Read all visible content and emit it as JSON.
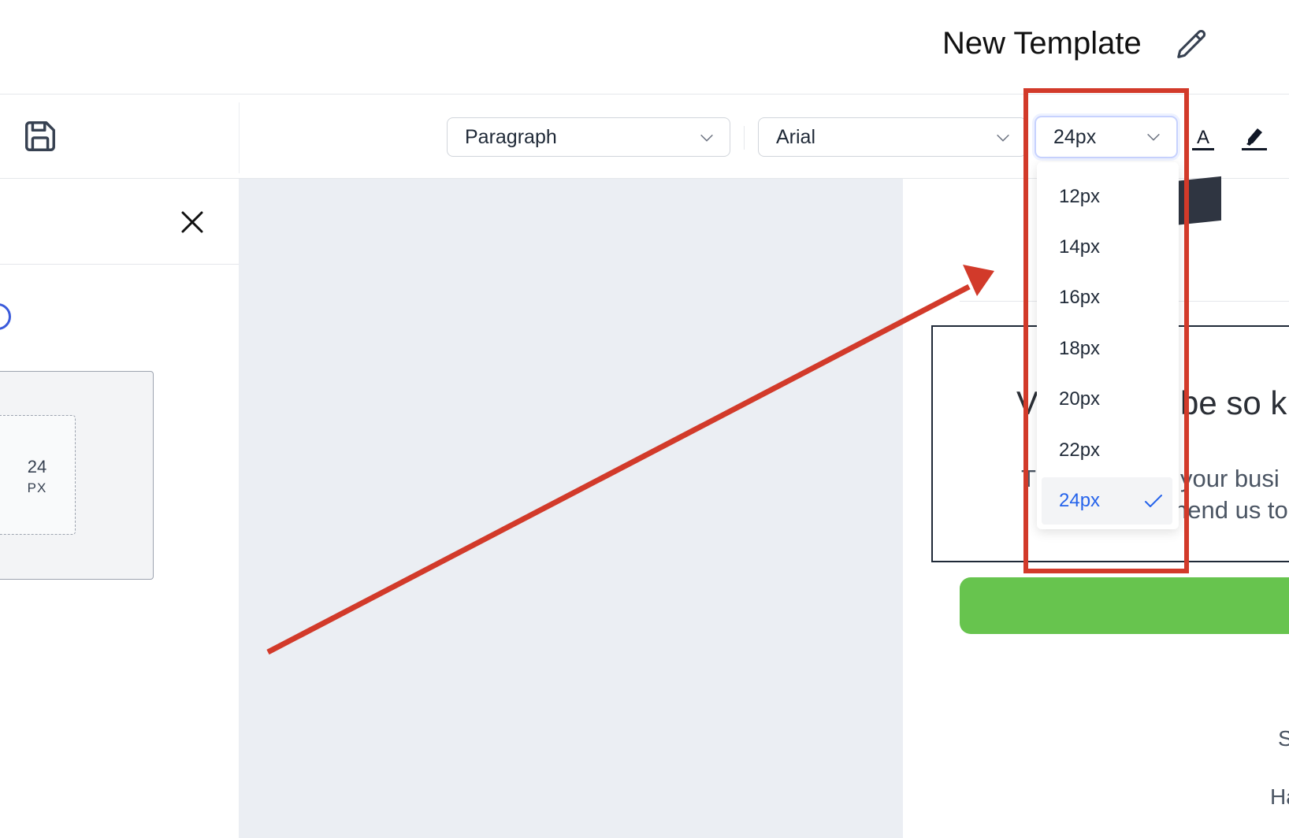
{
  "header": {
    "title": "New Template",
    "edit_icon": "pencil-icon"
  },
  "toolbar": {
    "save_icon": "save-icon",
    "block_type": "Paragraph",
    "font_family": "Arial",
    "font_size": "24px",
    "font_color_icon": "font-color-icon",
    "font_color_letter": "A",
    "highlight_icon": "highlight-icon"
  },
  "font_size_dropdown": {
    "options": [
      "12px",
      "14px",
      "16px",
      "18px",
      "20px",
      "22px",
      "24px"
    ],
    "selected": "24px"
  },
  "left_panel": {
    "close_icon": "close-icon",
    "padding_value": "24",
    "padding_unit": "PX"
  },
  "email_preview": {
    "heading_left": "V",
    "heading_right": "be so k",
    "text_left": "T",
    "text_line1": "your busi",
    "text_line2": "nend us to",
    "letter_s": "S",
    "letter_h": "Ha"
  },
  "colors": {
    "accent": "#2563eb",
    "annotation": "#d23a2a",
    "button_green": "#67c44e",
    "canvas_bg": "#ebeef3"
  }
}
